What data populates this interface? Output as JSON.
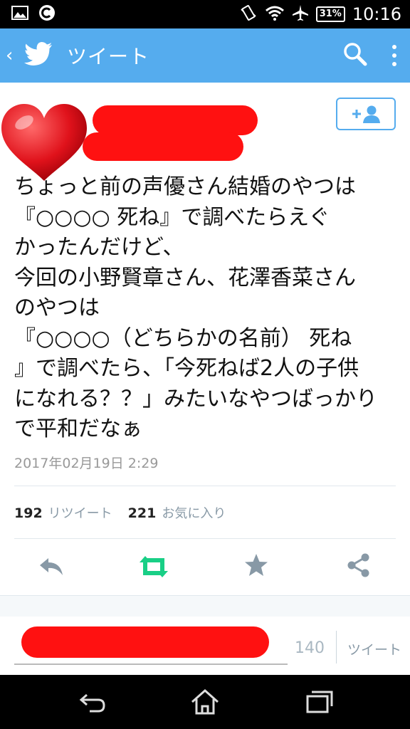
{
  "status_bar": {
    "time": "10:16",
    "battery": "31%",
    "icons": [
      "image-icon",
      "c-app-icon",
      "vibrate-icon",
      "wifi-icon",
      "airplane-icon",
      "battery-icon"
    ]
  },
  "app_bar": {
    "back_glyph": "‹",
    "title": "ツイート",
    "icons": [
      "twitter-bird-icon",
      "search-icon",
      "more-vert-icon"
    ],
    "color": "#55acee"
  },
  "tweet": {
    "text_lines": [
      "ちょっと前の声優さん結婚のやつは",
      "『○○○○ 死ね』で調べたらえぐ",
      "かったんだけど、",
      "今回の小野賢章さん、花澤香菜さん",
      "のやつは",
      "『○○○○（どちらかの名前） 死ね",
      "』で調べたら、「今死ねば2人の子供",
      "になれる？？」みたいなやつばっかり",
      "で平和だなぁ"
    ],
    "timestamp": "2017年02月19日 2:29"
  },
  "stats": {
    "retweet_count": "192",
    "retweet_label": "リツイート",
    "favorite_count": "221",
    "favorite_label": "お気に入り"
  },
  "actions": [
    "reply-icon",
    "retweet-icon",
    "favorite-icon",
    "share-icon"
  ],
  "composer": {
    "char_count": "140",
    "send_label": "ツイート"
  },
  "nav_bar": [
    "back-icon",
    "home-icon",
    "recents-icon"
  ],
  "colors": {
    "accent": "#55acee",
    "retweet_green": "#19cf86",
    "redaction": "#ff1111",
    "heart": "#e0121b"
  }
}
